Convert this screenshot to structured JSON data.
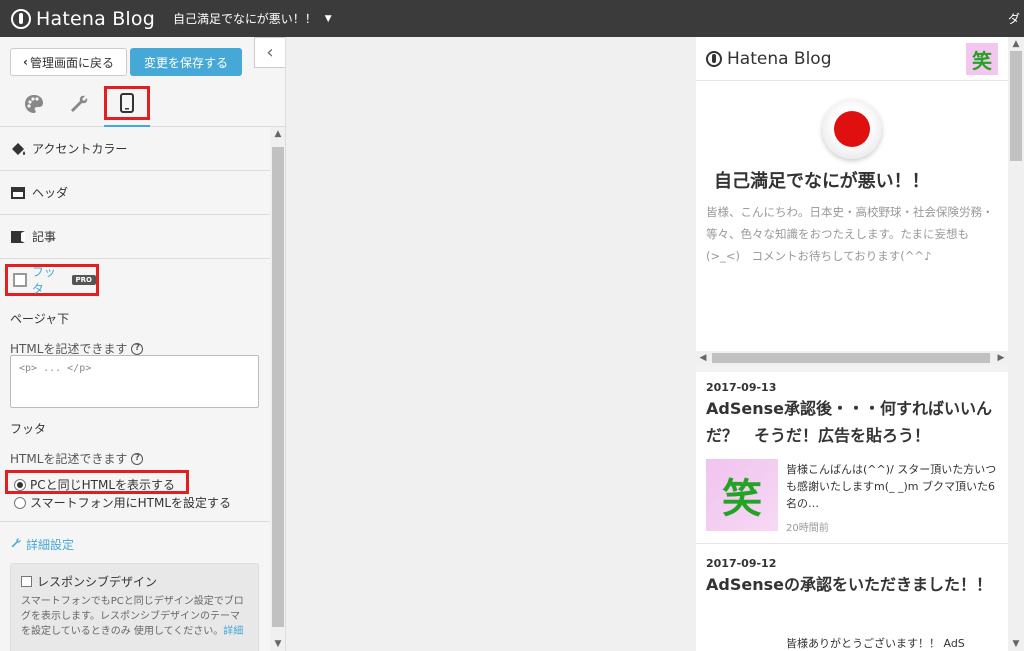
{
  "topbar": {
    "logo": "Hatena Blog",
    "blog_title": "自己満足でなにが悪い！！",
    "right_text": "ダ"
  },
  "left": {
    "back_label": "管理画面に戻る",
    "save_label": "変更を保存する",
    "sections": [
      {
        "label": "アクセントカラー"
      },
      {
        "label": "ヘッダ"
      },
      {
        "label": "記事"
      }
    ],
    "footer_label": "フッタ",
    "pro_badge": "PRO",
    "page_bottom_label": "ページャ下",
    "html_hint_1": "HTMLを記述できます",
    "textarea_placeholder": "<p> ... </p>",
    "footer_sub_label": "フッタ",
    "html_hint_2": "HTMLを記述できます",
    "radio_same": "PCと同じHTMLを表示する",
    "radio_custom": "スマートフォン用にHTMLを設定する",
    "advanced_label": "詳細設定",
    "responsive_label": "レスポンシブデザイン",
    "responsive_desc": "スマートフォンでもPCと同じデザイン設定でブログを表示します。レスポンシブデザインのテーマを設定しているときのみ 使用してください。",
    "responsive_link": "詳細"
  },
  "preview": {
    "logo": "Hatena Blog",
    "avatar_char": "笑",
    "blog_title": "自己満足でなにが悪い！！",
    "blog_desc": "皆様、こんにちわ。日本史・高校野球・社会保険労務・等々、色々な知識をおつたえします。たまに妄想も(>_<)　コメントお待ちしております(^^♪",
    "posts": [
      {
        "date": "2017-09-13",
        "title": "AdSense承認後・・・何すればいいんだ？　そうだ！広告を貼ろう！",
        "thumb_char": "笑",
        "excerpt": "皆様こんばんは(^^)/ スター頂いた方いつも感謝いたしますm(_ _)m ブクマ頂いた6名の…",
        "time": "20時間前"
      },
      {
        "date": "2017-09-12",
        "title": "AdSenseの承認をいただきました！！",
        "excerpt": "皆様ありがとうございます！！ AdS"
      }
    ]
  }
}
